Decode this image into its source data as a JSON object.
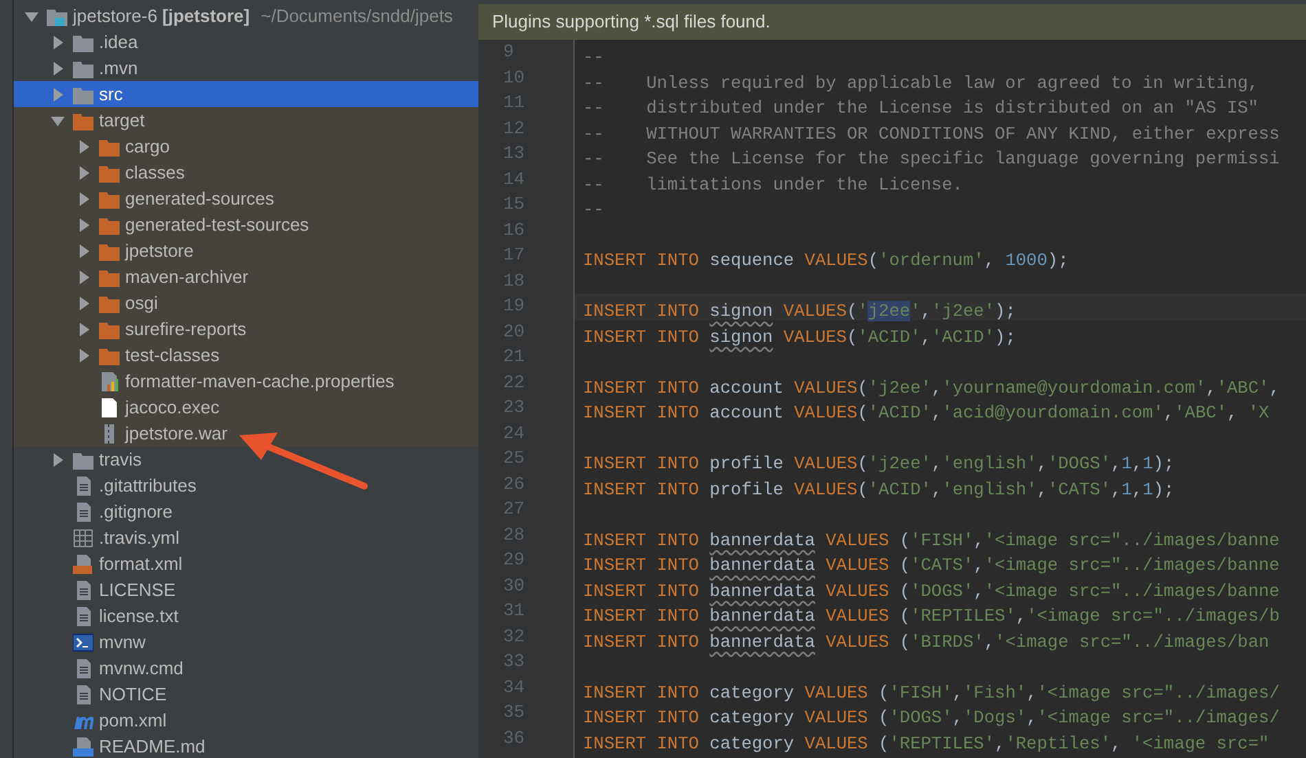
{
  "project_tree": {
    "root": {
      "label": "jpetstore-6 **[jpetstore]**",
      "path": "~/Documents/sndd/jpets",
      "kind": "module",
      "expanded": true,
      "selected": false,
      "children": [
        {
          "label": ".idea",
          "kind": "folder",
          "expanded": false,
          "selected": false
        },
        {
          "label": ".mvn",
          "kind": "folder",
          "expanded": false,
          "selected": false
        },
        {
          "label": "src",
          "kind": "folder",
          "expanded": false,
          "selected": true
        },
        {
          "label": "target",
          "kind": "excluded-folder",
          "expanded": true,
          "selected": false,
          "excluded": true,
          "children": [
            {
              "label": "cargo",
              "kind": "excluded-folder",
              "expanded": false,
              "selected": false
            },
            {
              "label": "classes",
              "kind": "excluded-folder",
              "expanded": false,
              "selected": false
            },
            {
              "label": "generated-sources",
              "kind": "excluded-folder",
              "expanded": false,
              "selected": false
            },
            {
              "label": "generated-test-sources",
              "kind": "excluded-folder",
              "expanded": false,
              "selected": false
            },
            {
              "label": "jpetstore",
              "kind": "excluded-folder",
              "expanded": false,
              "selected": false
            },
            {
              "label": "maven-archiver",
              "kind": "excluded-folder",
              "expanded": false,
              "selected": false
            },
            {
              "label": "osgi",
              "kind": "excluded-folder",
              "expanded": false,
              "selected": false
            },
            {
              "label": "surefire-reports",
              "kind": "excluded-folder",
              "expanded": false,
              "selected": false
            },
            {
              "label": "test-classes",
              "kind": "excluded-folder",
              "expanded": false,
              "selected": false
            },
            {
              "label": "formatter-maven-cache.properties",
              "kind": "properties",
              "selected": false
            },
            {
              "label": "jacoco.exec",
              "kind": "blank",
              "selected": false
            },
            {
              "label": "jpetstore.war",
              "kind": "archive",
              "selected": false
            }
          ]
        },
        {
          "label": "travis",
          "kind": "folder",
          "expanded": false,
          "selected": false
        },
        {
          "label": ".gitattributes",
          "kind": "text",
          "selected": false
        },
        {
          "label": ".gitignore",
          "kind": "text",
          "selected": false
        },
        {
          "label": ".travis.yml",
          "kind": "yaml",
          "selected": false
        },
        {
          "label": "format.xml",
          "kind": "xml",
          "selected": false
        },
        {
          "label": "LICENSE",
          "kind": "text",
          "selected": false
        },
        {
          "label": "license.txt",
          "kind": "text",
          "selected": false
        },
        {
          "label": "mvnw",
          "kind": "shell",
          "selected": false
        },
        {
          "label": "mvnw.cmd",
          "kind": "text",
          "selected": false
        },
        {
          "label": "NOTICE",
          "kind": "text",
          "selected": false
        },
        {
          "label": "pom.xml",
          "kind": "maven",
          "selected": false
        },
        {
          "label": "README.md",
          "kind": "markdown",
          "selected": false
        }
      ]
    }
  },
  "editor": {
    "notification": "Plugins supporting *.sql files found.",
    "lines": [
      {
        "number": "9",
        "tokens": [
          {
            "kind": "comment",
            "text": "--"
          }
        ]
      },
      {
        "number": "10",
        "tokens": [
          {
            "kind": "comment",
            "text": "--    Unless required by applicable law or agreed to in writing,"
          }
        ]
      },
      {
        "number": "11",
        "tokens": [
          {
            "kind": "comment",
            "text": "--    distributed under the License is distributed on an \"AS IS\""
          }
        ]
      },
      {
        "number": "12",
        "tokens": [
          {
            "kind": "comment",
            "text": "--    WITHOUT WARRANTIES OR CONDITIONS OF ANY KIND, either express"
          }
        ]
      },
      {
        "number": "13",
        "tokens": [
          {
            "kind": "comment",
            "text": "--    See the License for the specific language governing permissi"
          }
        ]
      },
      {
        "number": "14",
        "tokens": [
          {
            "kind": "comment",
            "text": "--    limitations under the License."
          }
        ]
      },
      {
        "number": "15",
        "tokens": [
          {
            "kind": "comment",
            "text": "--"
          }
        ]
      },
      {
        "number": "16"
      },
      {
        "number": "17",
        "tokens": [
          {
            "kind": "keyword",
            "text": "INSERT INTO"
          },
          {
            "kind": "plain",
            "text": " sequence "
          },
          {
            "kind": "keyword",
            "text": "VALUES"
          },
          {
            "kind": "plain",
            "text": "("
          },
          {
            "kind": "string",
            "text": "'ordernum'"
          },
          {
            "kind": "plain",
            "text": ", "
          },
          {
            "kind": "number",
            "text": "1000"
          },
          {
            "kind": "plain",
            "text": ");"
          }
        ]
      },
      {
        "number": "18"
      },
      {
        "number": "19",
        "current": true,
        "tokens": [
          {
            "kind": "keyword",
            "text": "INSERT INTO "
          },
          {
            "kind": "warning",
            "text": "signon"
          },
          {
            "kind": "keyword",
            "text": " VALUES"
          },
          {
            "kind": "plain",
            "text": "("
          },
          {
            "kind": "string",
            "text": "'"
          },
          {
            "kind": "highlight",
            "text": "j2ee"
          },
          {
            "kind": "string",
            "text": "'"
          },
          {
            "kind": "plain",
            "text": ","
          },
          {
            "kind": "string",
            "text": "'j2ee'"
          },
          {
            "kind": "plain",
            "text": ");"
          }
        ]
      },
      {
        "number": "20",
        "tokens": [
          {
            "kind": "keyword",
            "text": "INSERT INTO "
          },
          {
            "kind": "warning",
            "text": "signon"
          },
          {
            "kind": "keyword",
            "text": " VALUES"
          },
          {
            "kind": "plain",
            "text": "("
          },
          {
            "kind": "string",
            "text": "'ACID'"
          },
          {
            "kind": "plain",
            "text": ","
          },
          {
            "kind": "string",
            "text": "'ACID'"
          },
          {
            "kind": "plain",
            "text": ");"
          }
        ]
      },
      {
        "number": "21"
      },
      {
        "number": "22",
        "tokens": [
          {
            "kind": "keyword",
            "text": "INSERT INTO"
          },
          {
            "kind": "plain",
            "text": " account "
          },
          {
            "kind": "keyword",
            "text": "VALUES"
          },
          {
            "kind": "plain",
            "text": "("
          },
          {
            "kind": "string",
            "text": "'j2ee'"
          },
          {
            "kind": "plain",
            "text": ","
          },
          {
            "kind": "string",
            "text": "'yourname@yourdomain.com'"
          },
          {
            "kind": "plain",
            "text": ","
          },
          {
            "kind": "string",
            "text": "'ABC'"
          },
          {
            "kind": "plain",
            "text": ","
          }
        ]
      },
      {
        "number": "23",
        "tokens": [
          {
            "kind": "keyword",
            "text": "INSERT INTO"
          },
          {
            "kind": "plain",
            "text": " account "
          },
          {
            "kind": "keyword",
            "text": "VALUES"
          },
          {
            "kind": "plain",
            "text": "("
          },
          {
            "kind": "string",
            "text": "'ACID'"
          },
          {
            "kind": "plain",
            "text": ","
          },
          {
            "kind": "string",
            "text": "'acid@yourdomain.com'"
          },
          {
            "kind": "plain",
            "text": ","
          },
          {
            "kind": "string",
            "text": "'ABC'"
          },
          {
            "kind": "plain",
            "text": ", "
          },
          {
            "kind": "string",
            "text": "'X"
          }
        ]
      },
      {
        "number": "24"
      },
      {
        "number": "25",
        "tokens": [
          {
            "kind": "keyword",
            "text": "INSERT INTO"
          },
          {
            "kind": "plain",
            "text": " profile "
          },
          {
            "kind": "keyword",
            "text": "VALUES"
          },
          {
            "kind": "plain",
            "text": "("
          },
          {
            "kind": "string",
            "text": "'j2ee'"
          },
          {
            "kind": "plain",
            "text": ","
          },
          {
            "kind": "string",
            "text": "'english'"
          },
          {
            "kind": "plain",
            "text": ","
          },
          {
            "kind": "string",
            "text": "'DOGS'"
          },
          {
            "kind": "plain",
            "text": ","
          },
          {
            "kind": "number",
            "text": "1"
          },
          {
            "kind": "plain",
            "text": ","
          },
          {
            "kind": "number",
            "text": "1"
          },
          {
            "kind": "plain",
            "text": ");"
          }
        ]
      },
      {
        "number": "26",
        "tokens": [
          {
            "kind": "keyword",
            "text": "INSERT INTO"
          },
          {
            "kind": "plain",
            "text": " profile "
          },
          {
            "kind": "keyword",
            "text": "VALUES"
          },
          {
            "kind": "plain",
            "text": "("
          },
          {
            "kind": "string",
            "text": "'ACID'"
          },
          {
            "kind": "plain",
            "text": ","
          },
          {
            "kind": "string",
            "text": "'english'"
          },
          {
            "kind": "plain",
            "text": ","
          },
          {
            "kind": "string",
            "text": "'CATS'"
          },
          {
            "kind": "plain",
            "text": ","
          },
          {
            "kind": "number",
            "text": "1"
          },
          {
            "kind": "plain",
            "text": ","
          },
          {
            "kind": "number",
            "text": "1"
          },
          {
            "kind": "plain",
            "text": ");"
          }
        ]
      },
      {
        "number": "27"
      },
      {
        "number": "28",
        "tokens": [
          {
            "kind": "keyword",
            "text": "INSERT INTO "
          },
          {
            "kind": "warning",
            "text": "bannerdata"
          },
          {
            "kind": "keyword",
            "text": " VALUES"
          },
          {
            "kind": "plain",
            "text": " ("
          },
          {
            "kind": "string",
            "text": "'FISH'"
          },
          {
            "kind": "plain",
            "text": ","
          },
          {
            "kind": "string",
            "text": "'<image src=\"../images/banne"
          }
        ]
      },
      {
        "number": "29",
        "tokens": [
          {
            "kind": "keyword",
            "text": "INSERT INTO "
          },
          {
            "kind": "warning",
            "text": "bannerdata"
          },
          {
            "kind": "keyword",
            "text": " VALUES"
          },
          {
            "kind": "plain",
            "text": " ("
          },
          {
            "kind": "string",
            "text": "'CATS'"
          },
          {
            "kind": "plain",
            "text": ","
          },
          {
            "kind": "string",
            "text": "'<image src=\"../images/banne"
          }
        ]
      },
      {
        "number": "30",
        "tokens": [
          {
            "kind": "keyword",
            "text": "INSERT INTO "
          },
          {
            "kind": "warning",
            "text": "bannerdata"
          },
          {
            "kind": "keyword",
            "text": " VALUES"
          },
          {
            "kind": "plain",
            "text": " ("
          },
          {
            "kind": "string",
            "text": "'DOGS'"
          },
          {
            "kind": "plain",
            "text": ","
          },
          {
            "kind": "string",
            "text": "'<image src=\"../images/banne"
          }
        ]
      },
      {
        "number": "31",
        "tokens": [
          {
            "kind": "keyword",
            "text": "INSERT INTO "
          },
          {
            "kind": "warning",
            "text": "bannerdata"
          },
          {
            "kind": "keyword",
            "text": " VALUES"
          },
          {
            "kind": "plain",
            "text": " ("
          },
          {
            "kind": "string",
            "text": "'REPTILES'"
          },
          {
            "kind": "plain",
            "text": ","
          },
          {
            "kind": "string",
            "text": "'<image src=\"../images/b"
          }
        ]
      },
      {
        "number": "32",
        "tokens": [
          {
            "kind": "keyword",
            "text": "INSERT INTO "
          },
          {
            "kind": "warning",
            "text": "bannerdata"
          },
          {
            "kind": "keyword",
            "text": " VALUES"
          },
          {
            "kind": "plain",
            "text": " ("
          },
          {
            "kind": "string",
            "text": "'BIRDS'"
          },
          {
            "kind": "plain",
            "text": ","
          },
          {
            "kind": "string",
            "text": "'<image src=\"../images/ban"
          }
        ]
      },
      {
        "number": "33"
      },
      {
        "number": "34",
        "tokens": [
          {
            "kind": "keyword",
            "text": "INSERT INTO"
          },
          {
            "kind": "plain",
            "text": " category "
          },
          {
            "kind": "keyword",
            "text": "VALUES"
          },
          {
            "kind": "plain",
            "text": " ("
          },
          {
            "kind": "string",
            "text": "'FISH'"
          },
          {
            "kind": "plain",
            "text": ","
          },
          {
            "kind": "string",
            "text": "'Fish'"
          },
          {
            "kind": "plain",
            "text": ","
          },
          {
            "kind": "string",
            "text": "'<image src=\"../images/"
          }
        ]
      },
      {
        "number": "35",
        "tokens": [
          {
            "kind": "keyword",
            "text": "INSERT INTO"
          },
          {
            "kind": "plain",
            "text": " category "
          },
          {
            "kind": "keyword",
            "text": "VALUES"
          },
          {
            "kind": "plain",
            "text": " ("
          },
          {
            "kind": "string",
            "text": "'DOGS'"
          },
          {
            "kind": "plain",
            "text": ","
          },
          {
            "kind": "string",
            "text": "'Dogs'"
          },
          {
            "kind": "plain",
            "text": ","
          },
          {
            "kind": "string",
            "text": "'<image src=\"../images/"
          }
        ]
      },
      {
        "number": "36",
        "tokens": [
          {
            "kind": "keyword",
            "text": "INSERT INTO"
          },
          {
            "kind": "plain",
            "text": " category "
          },
          {
            "kind": "keyword",
            "text": "VALUES"
          },
          {
            "kind": "plain",
            "text": " ("
          },
          {
            "kind": "string",
            "text": "'REPTILES'"
          },
          {
            "kind": "plain",
            "text": ","
          },
          {
            "kind": "string",
            "text": "'Reptiles'"
          },
          {
            "kind": "plain",
            "text": ", "
          },
          {
            "kind": "string",
            "text": "'<image src=\""
          }
        ]
      }
    ]
  }
}
